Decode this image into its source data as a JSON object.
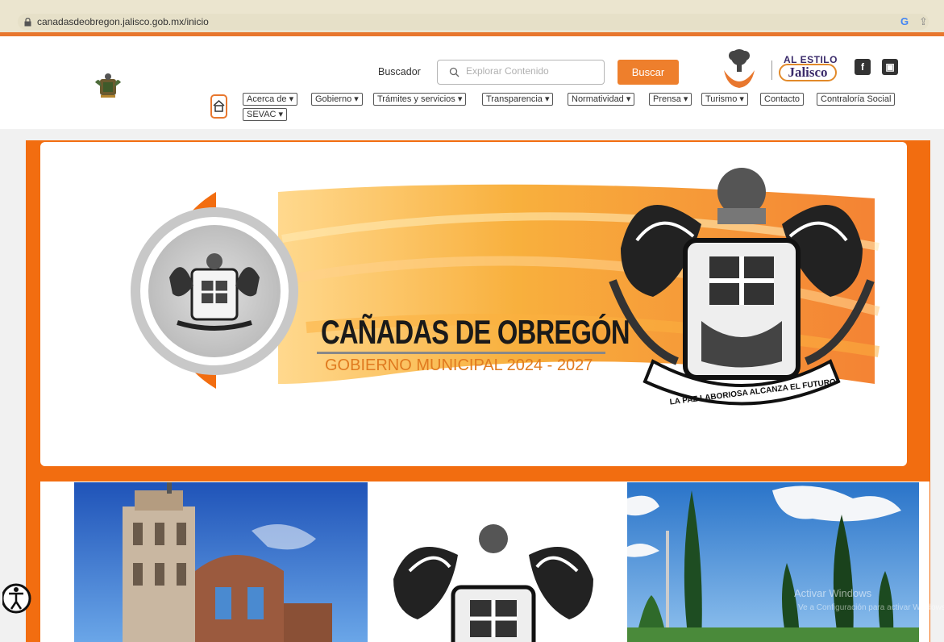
{
  "browser": {
    "url": "canadasdeobregon.jalisco.gob.mx/inicio"
  },
  "header": {
    "search_label": "Buscador",
    "search_placeholder": "Explorar Contenido",
    "search_button": "Buscar",
    "jalisco_top": "AL ESTILO",
    "jalisco_bottom": "Jalisco"
  },
  "nav": {
    "items": [
      {
        "label": "Acerca de ▾"
      },
      {
        "label": "Gobierno ▾"
      },
      {
        "label": "Trámites y servicios ▾"
      },
      {
        "label": "Transparencia ▾"
      },
      {
        "label": "Normatividad ▾"
      },
      {
        "label": "Prensa ▾"
      },
      {
        "label": "Turismo ▾"
      },
      {
        "label": "Contacto"
      },
      {
        "label": "Contraloría Social"
      },
      {
        "label": "SEVAC ▾"
      }
    ]
  },
  "banner": {
    "title": "CAÑADAS DE OBREGÓN",
    "subtitle": "GOBIERNO MUNICIPAL 2024 - 2027",
    "motto": "LA PAZ LABORIOSA ALCANZA EL FUTURO"
  },
  "overlay": {
    "activate_windows": "Activar Windows",
    "activate_hint": "Ve a Configuración para activar Windows."
  },
  "colors": {
    "accent": "#f26d10",
    "button": "#ee7f2c",
    "subtitle": "#e07a1f"
  }
}
